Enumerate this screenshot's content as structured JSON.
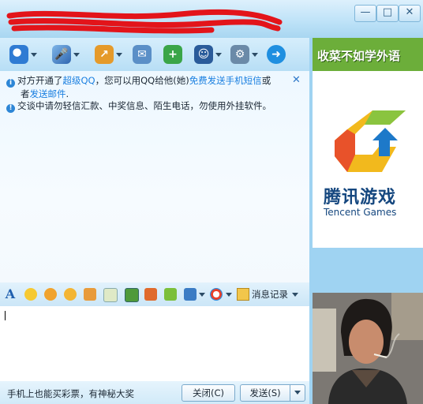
{
  "window": {
    "minimize": "—",
    "maximize": "□",
    "close": "✕"
  },
  "toolbar": [
    {
      "icon": "video-call-icon",
      "color": "#2f7bd3"
    },
    {
      "icon": "voice-call-icon",
      "color": "#4a8fd8"
    },
    {
      "icon": "send-file-icon",
      "color": "#e59a2a"
    },
    {
      "icon": "sms-icon",
      "color": "#5a8fc7"
    },
    {
      "icon": "create-group-icon",
      "color": "#3aa548"
    },
    {
      "icon": "remote-assist-icon",
      "color": "#2a5b9a"
    },
    {
      "icon": "app-settings-icon",
      "color": "#6b8aa8"
    },
    {
      "icon": "share-icon",
      "color": "#1f8fe0"
    }
  ],
  "notices": {
    "line1_a": "对方开通了",
    "line1_link1": "超级QQ",
    "line1_b": "，您可以用QQ给他(她)",
    "line1_link2": "免费发送手机短信",
    "line1_c": "或",
    "line2_a": "者",
    "line2_link": "发送邮件",
    "line2_b": ".",
    "line3": "交谈中请勿轻信汇款、中奖信息、陌生电话，勿使用外挂软件。"
  },
  "format_bar": {
    "font_icon": "A",
    "history_label": "消息记录"
  },
  "bottom": {
    "tip": "手机上也能买彩票，有神秘大奖",
    "close_button": "关闭(C)",
    "send_button": "发送(S)"
  },
  "ad": {
    "banner_text": "收菜不如学外语",
    "logo_cn": "腾讯游戏",
    "logo_en": "Tencent Games"
  }
}
